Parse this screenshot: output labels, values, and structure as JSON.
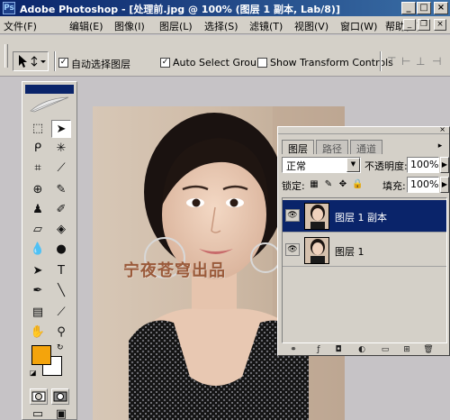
{
  "titlebar": {
    "app_icon": "Ps",
    "title": "Adobe Photoshop - [处理前.jpg @ 100% (图层 1 副本, Lab/8)]",
    "minimize": "_",
    "maximize": "□",
    "close": "×"
  },
  "menu": {
    "items": [
      "文件(F)",
      "编辑(E)",
      "图像(I)",
      "图层(L)",
      "选择(S)",
      "滤镜(T)",
      "视图(V)",
      "窗口(W)",
      "帮助(H)"
    ],
    "doc_minimize": "_",
    "doc_restore": "❐",
    "doc_close": "×"
  },
  "options": {
    "tool_preset_icon": "move-tool-icon",
    "auto_select_layer_label": "自动选择图层",
    "auto_select_layer_checked": true,
    "auto_select_groups_label": "Auto Select Groups",
    "auto_select_groups_checked": true,
    "show_transform_label": "Show Transform Controls",
    "show_transform_checked": false,
    "check_mark": "✓"
  },
  "toolbox": {
    "active_tool": "move-tool",
    "foreground_color": "#f4a40c",
    "background_color": "#ffffff"
  },
  "canvas": {
    "watermark": "宁夜苍穹出品"
  },
  "layers_panel": {
    "tabs": [
      "图层",
      "路径",
      "通道"
    ],
    "active_tab": "图层",
    "close_glyph": "×",
    "menu_glyph": "▸",
    "blend_mode": "正常",
    "opacity_label": "不透明度:",
    "opacity_value": "100%",
    "lock_label": "锁定:",
    "fill_label": "填充:",
    "fill_value": "100%",
    "layers": [
      {
        "name": "图层 1 副本",
        "selected": true,
        "visible": true
      },
      {
        "name": "图层 1",
        "selected": false,
        "visible": true
      }
    ],
    "eye_glyph": "👁",
    "arrow_glyph": "▶",
    "dropdown_glyph": "▼"
  }
}
